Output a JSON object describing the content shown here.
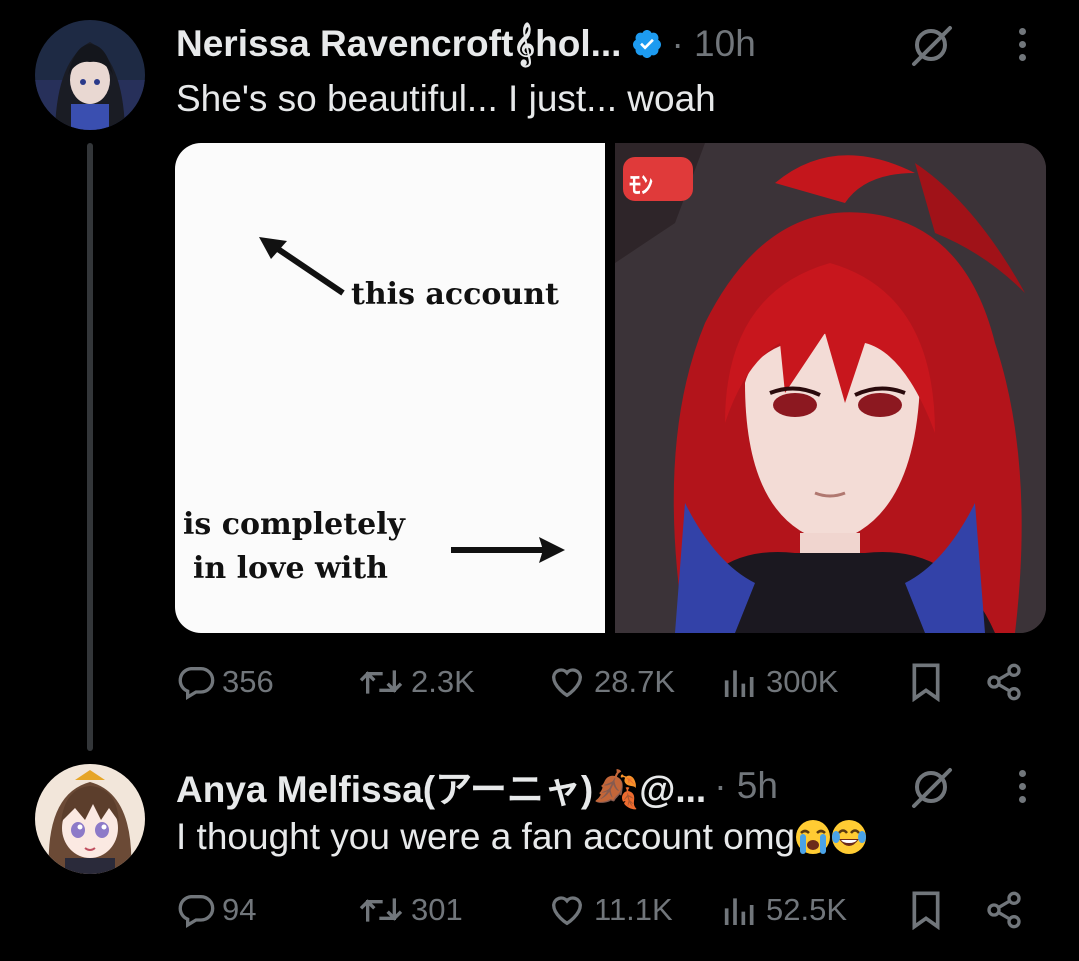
{
  "tweets": [
    {
      "author_name": "Nerissa Ravencroft𝄞hol...",
      "time": "· 10h",
      "text": "She's so beautiful... I just... woah",
      "media": {
        "meme_line_1": "this account",
        "meme_line_2": "is completely",
        "meme_line_3": "in love with",
        "overlay_badge": "ﾓﾝ"
      },
      "stats": {
        "replies": "356",
        "reposts": "2.3K",
        "likes": "28.7K",
        "views": "300K"
      }
    },
    {
      "author_name": "Anya Melfissa(アーニャ)🍂@...",
      "time": "· 5h",
      "text": "I thought you were a fan account omg",
      "emojis": [
        "loudly-crying-face",
        "face-with-tears-of-joy"
      ],
      "stats": {
        "replies": "94",
        "reposts": "301",
        "likes": "11.1K",
        "views": "52.5K"
      }
    }
  ],
  "colors": {
    "background": "#000000",
    "text": "#e7e9ea",
    "muted": "#71767b",
    "verified": "#1d9bf0"
  },
  "icons": [
    "reply-icon",
    "repost-icon",
    "like-icon",
    "views-icon",
    "bookmark-icon",
    "share-icon",
    "grok-icon",
    "more-icon",
    "verified-icon"
  ]
}
